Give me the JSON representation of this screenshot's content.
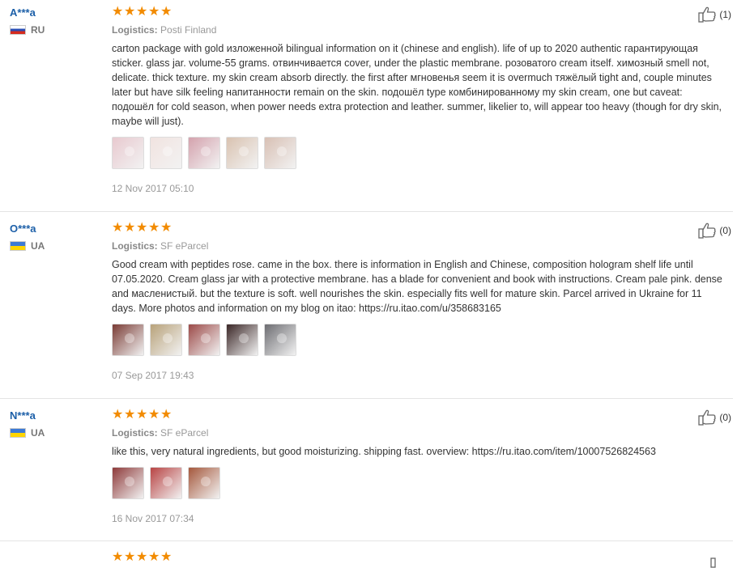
{
  "reviews": [
    {
      "user": "A***a",
      "country": "RU",
      "flag": "ru",
      "logistics_label": "Logistics:",
      "logistics_value": "Posti Finland",
      "content": "carton package with gold изложенной bilingual information on it (chinese and english). life of up to 2020 authentic гарантирующая sticker. glass jar. volume-55 grams. отвинчивается cover, under the plastic membrane. розоватого cream itself. химозный smell not, delicate. thick texture. my skin cream absorb directly. the first after мгновенья seem it is overmuch тяжёлый tight and, couple minutes later but have silk feeling напитанности remain on the skin. подошёл type комбинированному my skin cream, one but caveat: подошёл for cold season, when power needs extra protection and leather. summer, likelier to, will appear too heavy (though for dry skin, maybe will just).",
      "date": "12 Nov 2017 05:10",
      "likes": "(1)",
      "photo_colors": [
        "#e8c9cf",
        "#f1e3e0",
        "#d4a2ad",
        "#d9c2b0",
        "#d8c0b4"
      ]
    },
    {
      "user": "O***a",
      "country": "UA",
      "flag": "ua",
      "logistics_label": "Logistics:",
      "logistics_value": "SF eParcel",
      "content": "Good cream with peptides rose. came in the box. there is information in English and Chinese, composition hologram shelf life until 07.05.2020. Cream glass jar with a protective membrane. has a blade for convenient and book with instructions. Cream pale pink. dense and масленистый. but the texture is soft. well nourishes the skin. especially fits well for mature skin. Parcel arrived in Ukraine for 11 days. More photos and information on my blog on itao: https://ru.itao.com/u/358683165",
      "date": "07 Sep 2017 19:43",
      "likes": "(0)",
      "photo_colors": [
        "#7a3b34",
        "#b8a27a",
        "#9c4a48",
        "#3a2626",
        "#6d6d72"
      ]
    },
    {
      "user": "N***a",
      "country": "UA",
      "flag": "ua",
      "logistics_label": "Logistics:",
      "logistics_value": "SF eParcel",
      "content": "like this, very natural ingredients, but good moisturizing. shipping fast. overview: https://ru.itao.com/item/10007526824563",
      "date": "16 Nov 2017 07:34",
      "likes": "(0)",
      "photo_colors": [
        "#8e3a3a",
        "#b84444",
        "#a5583c"
      ]
    }
  ],
  "star_count": 5,
  "colors": {
    "user": "#1c5fa8",
    "star": "#f28b00",
    "muted": "#999999"
  },
  "icons": {
    "like": "thumbs-up-icon",
    "star": "star-icon"
  }
}
